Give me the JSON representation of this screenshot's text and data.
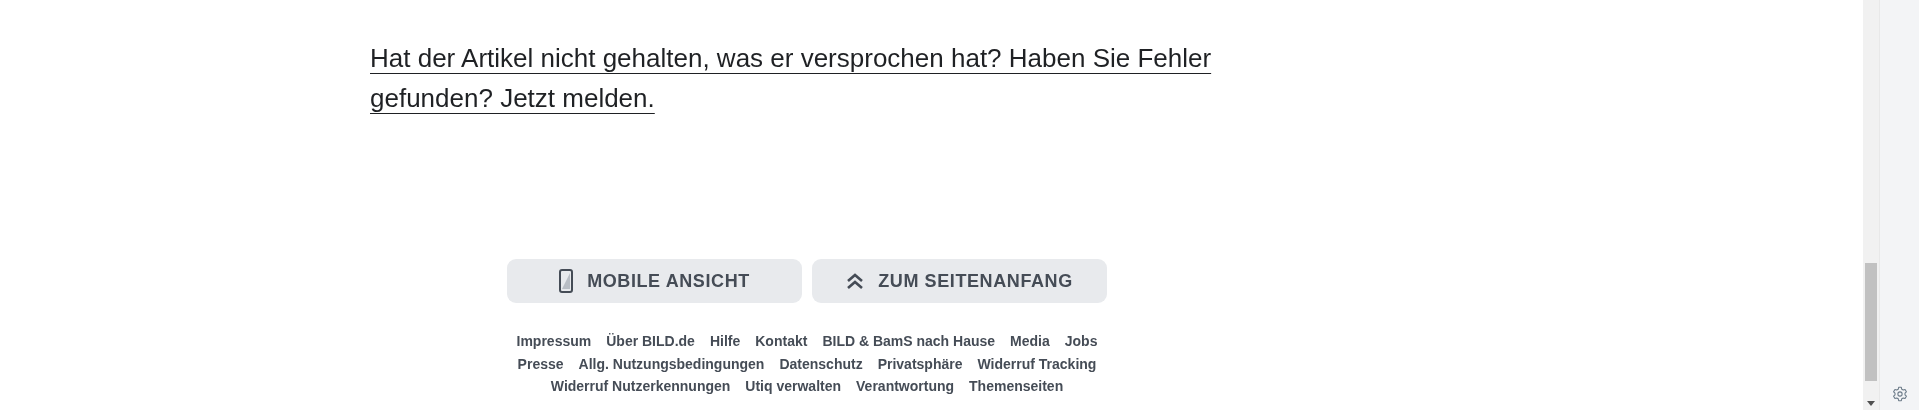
{
  "feedback_link": "Hat der Artikel nicht gehalten, was er versprochen hat? Haben Sie Fehler gefunden? Jetzt melden.",
  "buttons": [
    {
      "kind": "mobile",
      "label": "MOBILE ANSICHT"
    },
    {
      "kind": "top",
      "label": "ZUM SEITENANFANG"
    }
  ],
  "footer_links": [
    "Impressum",
    "Über BILD.de",
    "Hilfe",
    "Kontakt",
    "BILD & BamS nach Hause",
    "Media",
    "Jobs",
    "Presse",
    "Allg. Nutzungsbedingungen",
    "Datenschutz",
    "Privatsphäre",
    "Widerruf Tracking",
    "Widerruf Nutzerkennungen",
    "Utiq verwalten",
    "Verantwortung",
    "Themenseiten"
  ]
}
